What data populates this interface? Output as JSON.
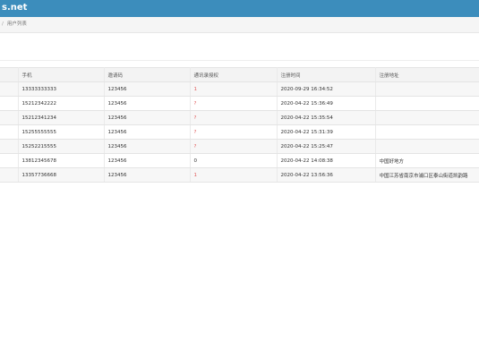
{
  "header": {
    "brand": "s.net"
  },
  "breadcrumb": {
    "separator": "/",
    "current": "用户列表"
  },
  "table": {
    "columns": [
      "手机",
      "邀请码",
      "通讯录授权",
      "注册时间",
      "注册地址"
    ],
    "rows": [
      {
        "phone": "13333333333",
        "invite": "123456",
        "auth": "1",
        "auth_highlight": true,
        "time": "2020-09-29 16:34:52",
        "address": ""
      },
      {
        "phone": "15212342222",
        "invite": "123456",
        "auth": "?",
        "auth_highlight": true,
        "time": "2020-04-22 15:36:49",
        "address": ""
      },
      {
        "phone": "15212341234",
        "invite": "123456",
        "auth": "?",
        "auth_highlight": true,
        "time": "2020-04-22 15:35:54",
        "address": ""
      },
      {
        "phone": "15255555555",
        "invite": "123456",
        "auth": "?",
        "auth_highlight": true,
        "time": "2020-04-22 15:31:39",
        "address": ""
      },
      {
        "phone": "15252215555",
        "invite": "123456",
        "auth": "?",
        "auth_highlight": true,
        "time": "2020-04-22 15:25:47",
        "address": ""
      },
      {
        "phone": "13812345678",
        "invite": "123456",
        "auth": "0",
        "auth_highlight": false,
        "time": "2020-04-22 14:08:38",
        "address": "中国好地方"
      },
      {
        "phone": "13357736668",
        "invite": "123456",
        "auth": "1",
        "auth_highlight": true,
        "time": "2020-04-22 13:56:36",
        "address": "中国江苏省南京市浦口区泰山街道凯韵路"
      }
    ]
  },
  "colors": {
    "header_bg": "#3c8dbc",
    "highlight": "#e05a5a"
  }
}
